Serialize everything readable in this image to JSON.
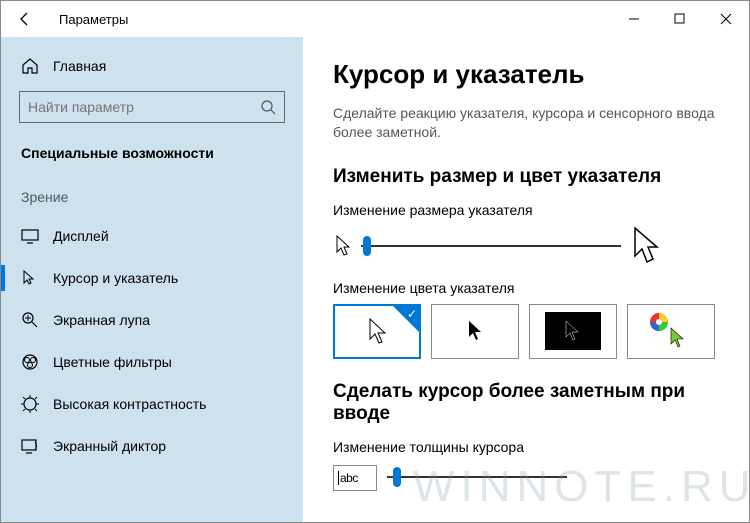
{
  "titlebar": {
    "back_aria": "Back",
    "title": "Параметры"
  },
  "sidebar": {
    "home_label": "Главная",
    "search_placeholder": "Найти параметр",
    "active_section": "Специальные возможности",
    "group_header": "Зрение",
    "items": [
      {
        "label": "Дисплей"
      },
      {
        "label": "Курсор и указатель"
      },
      {
        "label": "Экранная лупа"
      },
      {
        "label": "Цветные фильтры"
      },
      {
        "label": "Высокая контрастность"
      },
      {
        "label": "Экранный диктор"
      }
    ]
  },
  "content": {
    "title": "Курсор и указатель",
    "description": "Сделайте реакцию указателя, курсора и сенсорного ввода более заметной.",
    "section_pointer_h": "Изменить размер и цвет указателя",
    "size_label": "Изменение размера указателя",
    "color_label": "Изменение цвета указателя",
    "section_cursor_h": "Сделать курсор более заметным при вводе",
    "thickness_label": "Изменение толщины курсора",
    "preview_text": "abc"
  },
  "watermark": "WINNOTE.RU"
}
